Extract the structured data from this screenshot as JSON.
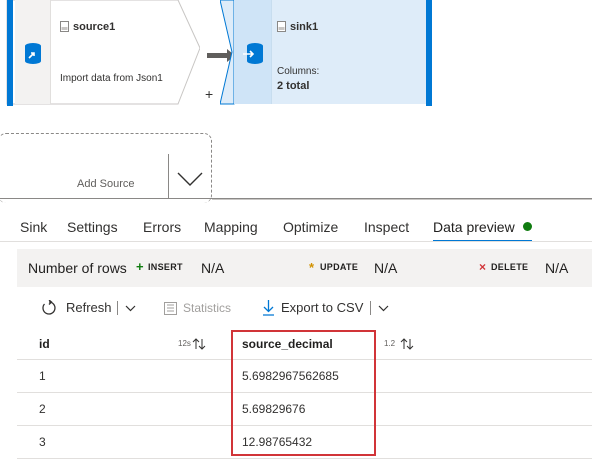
{
  "canvas": {
    "source": {
      "name": "source1",
      "description": "Import data from Json1"
    },
    "sink": {
      "name": "sink1",
      "columns_label": "Columns:",
      "columns_value": "2 total"
    },
    "add_source_label": "Add Source",
    "plus": "+"
  },
  "tabs": [
    {
      "label": "Sink"
    },
    {
      "label": "Settings"
    },
    {
      "label": "Errors"
    },
    {
      "label": "Mapping"
    },
    {
      "label": "Optimize"
    },
    {
      "label": "Inspect"
    },
    {
      "label": "Data preview",
      "active": true
    }
  ],
  "counts": {
    "label": "Number of rows",
    "insert": {
      "symbol": "+",
      "tag": "INSERT",
      "value": "N/A",
      "color": "#107c10"
    },
    "update": {
      "symbol": "*",
      "tag": "UPDATE",
      "value": "N/A",
      "color": "#d29200"
    },
    "delete": {
      "symbol": "×",
      "tag": "DELETE",
      "value": "N/A",
      "color": "#d13438"
    }
  },
  "toolbar": {
    "refresh": "Refresh",
    "statistics": "Statistics",
    "export": "Export to CSV"
  },
  "table": {
    "columns": [
      {
        "name": "id",
        "type": "12s"
      },
      {
        "name": "source_decimal",
        "type": "1.2"
      }
    ],
    "rows": [
      [
        "1",
        "5.6982967562685"
      ],
      [
        "2",
        "5.69829676"
      ],
      [
        "3",
        "12.98765432"
      ]
    ]
  },
  "colors": {
    "accent": "#0078d4",
    "status_dot": "#107c10",
    "highlight": "#d13438"
  }
}
